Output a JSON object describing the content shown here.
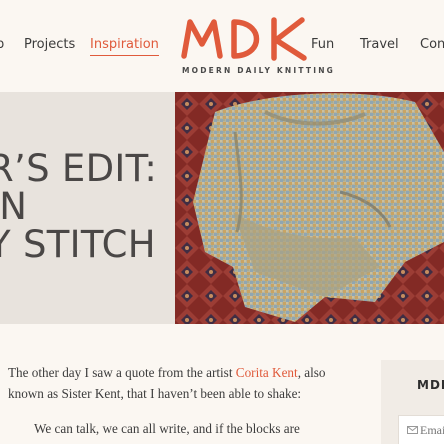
{
  "header": {
    "nav_left": [
      "Projects",
      "Inspiration"
    ],
    "nav_right": [
      "Fun",
      "Travel",
      "Con"
    ],
    "active": "Inspiration",
    "logo_text": "MDK",
    "logo_tagline": "MODERN DAILY KNITTING",
    "partial_left_char": "p"
  },
  "hero": {
    "title_lines": [
      "R’S EDIT:",
      "IN",
      "Y STITCH"
    ],
    "image_alt": "Multicolored knit sweater laid on a red patterned rug"
  },
  "article": {
    "paragraph_before_link": "The other day I saw a quote from the artist ",
    "link_text": "Corita Kent",
    "paragraph_after_link": ", also known as Sister Kent, that I haven’t been able to shake:",
    "quote": "We can talk, we can all write, and if the blocks are"
  },
  "sidebar": {
    "title": "MDK",
    "email_placeholder": "Email"
  },
  "colors": {
    "accent": "#e05a3b",
    "background": "#fbf7f2",
    "hero_bg": "#e8e3dd"
  }
}
